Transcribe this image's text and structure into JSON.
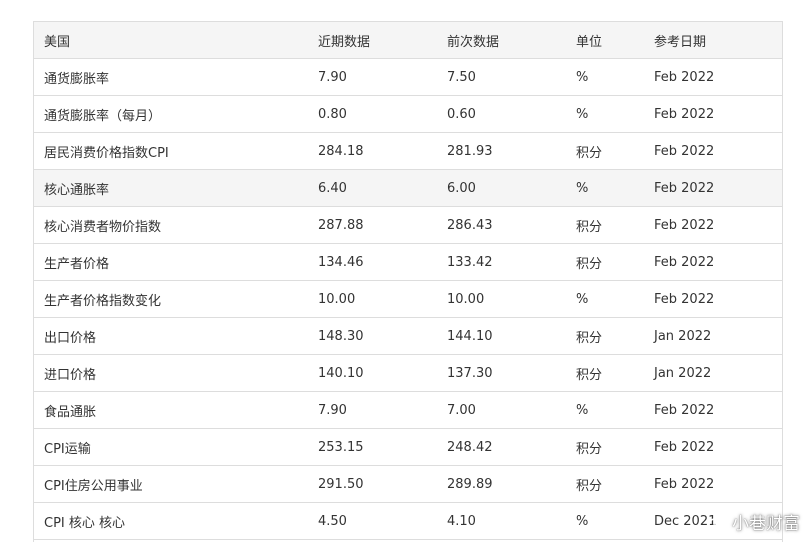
{
  "table": {
    "headers": [
      "美国",
      "近期数据",
      "前次数据",
      "单位",
      "参考日期"
    ],
    "rows": [
      [
        "通货膨胀率",
        "7.90",
        "7.50",
        "%",
        "Feb 2022"
      ],
      [
        "通货膨胀率（每月）",
        "0.80",
        "0.60",
        "%",
        "Feb 2022"
      ],
      [
        "居民消费价格指数CPI",
        "284.18",
        "281.93",
        "积分",
        "Feb 2022"
      ],
      [
        "核心通胀率",
        "6.40",
        "6.00",
        "%",
        "Feb 2022"
      ],
      [
        "核心消费者物价指数",
        "287.88",
        "286.43",
        "积分",
        "Feb 2022"
      ],
      [
        "生产者价格",
        "134.46",
        "133.42",
        "积分",
        "Feb 2022"
      ],
      [
        "生产者价格指数变化",
        "10.00",
        "10.00",
        "%",
        "Feb 2022"
      ],
      [
        "出口价格",
        "148.30",
        "144.10",
        "积分",
        "Jan 2022"
      ],
      [
        "进口价格",
        "140.10",
        "137.30",
        "积分",
        "Jan 2022"
      ],
      [
        "食品通胀",
        "7.90",
        "7.00",
        "%",
        "Feb 2022"
      ],
      [
        "CPI运输",
        "253.15",
        "248.42",
        "积分",
        "Feb 2022"
      ],
      [
        "CPI住房公用事业",
        "291.50",
        "289.89",
        "积分",
        "Feb 2022"
      ],
      [
        "CPI 核心 核心",
        "4.50",
        "4.10",
        "%",
        "Dec 2021"
      ]
    ],
    "highlighted_row": 3
  },
  "watermark": {
    "text": "小巷财富",
    "icon": "weibo-logo-icon"
  }
}
